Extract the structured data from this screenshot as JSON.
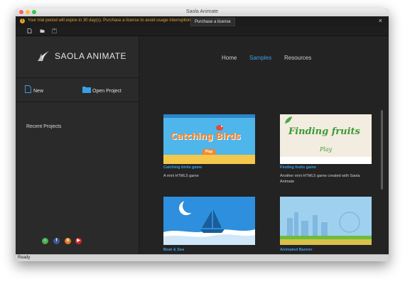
{
  "window": {
    "title": "Saola Animate"
  },
  "trial": {
    "message": "Your trial period will expire in 30 day(s). Purchase a license to avoid usage interruption.",
    "purchase_label": "Purchase a license",
    "close_glyph": "×"
  },
  "toolbar": {
    "icons": [
      "new-file-icon",
      "open-folder-icon",
      "save-icon"
    ]
  },
  "sidebar": {
    "logo_text": "SAOLA ANIMATE",
    "new_label": "New",
    "open_label": "Open Project",
    "recent_title": "Recent Projects",
    "social": [
      {
        "name": "community-icon",
        "glyph": "⌂",
        "color": "#4caf50"
      },
      {
        "name": "facebook-icon",
        "glyph": "f",
        "color": "#3b5998"
      },
      {
        "name": "blog-icon",
        "glyph": "b",
        "color": "#e07b20"
      },
      {
        "name": "youtube-icon",
        "glyph": "▶",
        "color": "#d9252a"
      }
    ]
  },
  "nav": {
    "tabs": [
      "Home",
      "Samples",
      "Resources"
    ],
    "active": "Samples"
  },
  "samples": [
    {
      "title": "Catching birds game",
      "desc": "A mini HTML5 game",
      "img_text": "Catching Birds",
      "play": "Play"
    },
    {
      "title": "Finding fruits game",
      "desc": "Another mini HTML5 game created with Saola Animate",
      "img_text": "Finding fruits",
      "play": "Play"
    },
    {
      "title": "Boat & Sea",
      "desc": ""
    },
    {
      "title": "Animated Banner",
      "desc": ""
    }
  ],
  "status": {
    "text": "Ready"
  },
  "colors": {
    "accent": "#3aa0e6",
    "warning": "#e3a126"
  }
}
